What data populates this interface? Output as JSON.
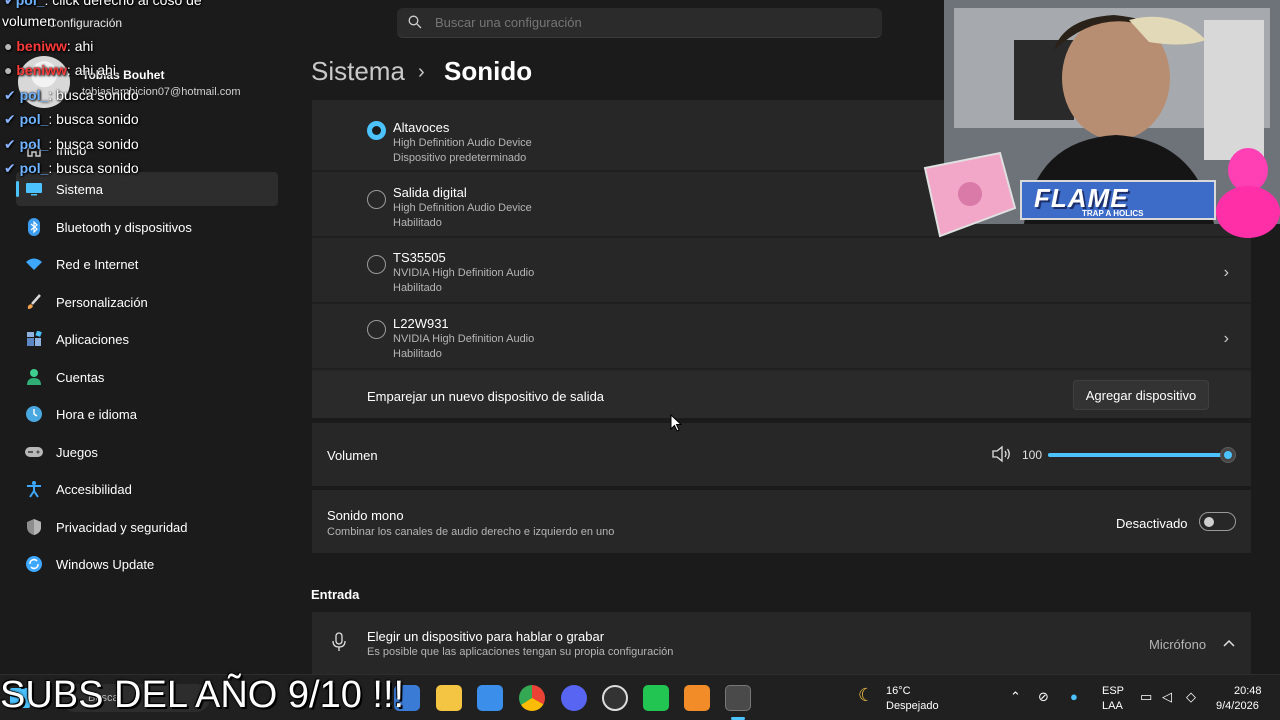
{
  "app": {
    "title": "Configuración"
  },
  "user": {
    "name": "Tobias Bouhet",
    "email": "tobiaslambicion07@hotmail.com"
  },
  "search": {
    "placeholder": "Buscar una configuración"
  },
  "breadcrumb": {
    "parent": "Sistema",
    "separator": "›",
    "current": "Sonido"
  },
  "sidebar": {
    "items": [
      {
        "label": "Inicio",
        "icon": "home-icon",
        "color": "#cfcfcf"
      },
      {
        "label": "Sistema",
        "icon": "system-icon",
        "color": "#4cc2ff",
        "active": true
      },
      {
        "label": "Bluetooth y dispositivos",
        "icon": "bluetooth-icon",
        "color": "#3b9cf0"
      },
      {
        "label": "Red e Internet",
        "icon": "network-icon",
        "color": "#3ea8ff"
      },
      {
        "label": "Personalización",
        "icon": "brush-icon",
        "color": "#f0a04a"
      },
      {
        "label": "Aplicaciones",
        "icon": "apps-icon",
        "color": "#7aa7d8"
      },
      {
        "label": "Cuentas",
        "icon": "accounts-icon",
        "color": "#3ecf8e"
      },
      {
        "label": "Hora e idioma",
        "icon": "time-language-icon",
        "color": "#4aa8e0"
      },
      {
        "label": "Juegos",
        "icon": "gaming-icon",
        "color": "#b8b8b8"
      },
      {
        "label": "Accesibilidad",
        "icon": "accessibility-icon",
        "color": "#3ea8ff"
      },
      {
        "label": "Privacidad y seguridad",
        "icon": "shield-icon",
        "color": "#9a9a9a"
      },
      {
        "label": "Windows Update",
        "icon": "update-icon",
        "color": "#3ea8ff"
      }
    ]
  },
  "output_devices": [
    {
      "name": "Altavoces",
      "line1": "High Definition Audio Device",
      "line2": "Dispositivo predeterminado",
      "selected": true,
      "chevron": false
    },
    {
      "name": "Salida digital",
      "line1": "High Definition Audio Device",
      "line2": "Habilitado",
      "selected": false,
      "chevron": false
    },
    {
      "name": "TS35505",
      "line1": "NVIDIA High Definition Audio",
      "line2": "Habilitado",
      "selected": false,
      "chevron": true
    },
    {
      "name": "L22W931",
      "line1": "NVIDIA High Definition Audio",
      "line2": "Habilitado",
      "selected": false,
      "chevron": true
    }
  ],
  "pair": {
    "label": "Emparejar un nuevo dispositivo de salida",
    "button": "Agregar dispositivo"
  },
  "volume": {
    "label": "Volumen",
    "value": "100",
    "level": 1.0
  },
  "mono": {
    "title": "Sonido mono",
    "description": "Combinar los canales de audio derecho e izquierdo en uno",
    "state": "Desactivado"
  },
  "input_section": {
    "title": "Entrada"
  },
  "input_device": {
    "title": "Elegir un dispositivo para hablar o grabar",
    "description": "Es posible que las aplicaciones tengan su propia configuración",
    "value": "Micrófono"
  },
  "chat": {
    "lines": [
      {
        "user": "pol_",
        "message": ": click derecho al coso de"
      },
      {
        "user": "",
        "message": "volumen"
      },
      {
        "user": "beniww",
        "message": ": ahi"
      },
      {
        "user": "beniww",
        "message": ": ahi ahi"
      },
      {
        "user": "pol_",
        "message": ": busca sonido"
      },
      {
        "user": "pol_",
        "message": ": busca sonido"
      },
      {
        "user": "pol_",
        "message": ": busca sonido"
      },
      {
        "user": "pol_",
        "message": ": busca sonido"
      }
    ]
  },
  "overlay": {
    "banner": "FLAME",
    "banner_sub": "TRAP A HOLICS",
    "caption": "SUBS DEL AÑO 9/10 !!!"
  },
  "taskbar": {
    "search": "Buscar",
    "weather_temp": "16°C",
    "weather_desc": "Despejado",
    "lang1": "ESP",
    "lang2": "LAA",
    "time": "20:48",
    "date": "9/4/2026"
  },
  "colors": {
    "accent": "#4cc2ff",
    "background": "#1b1b1b",
    "card": "#272727"
  }
}
